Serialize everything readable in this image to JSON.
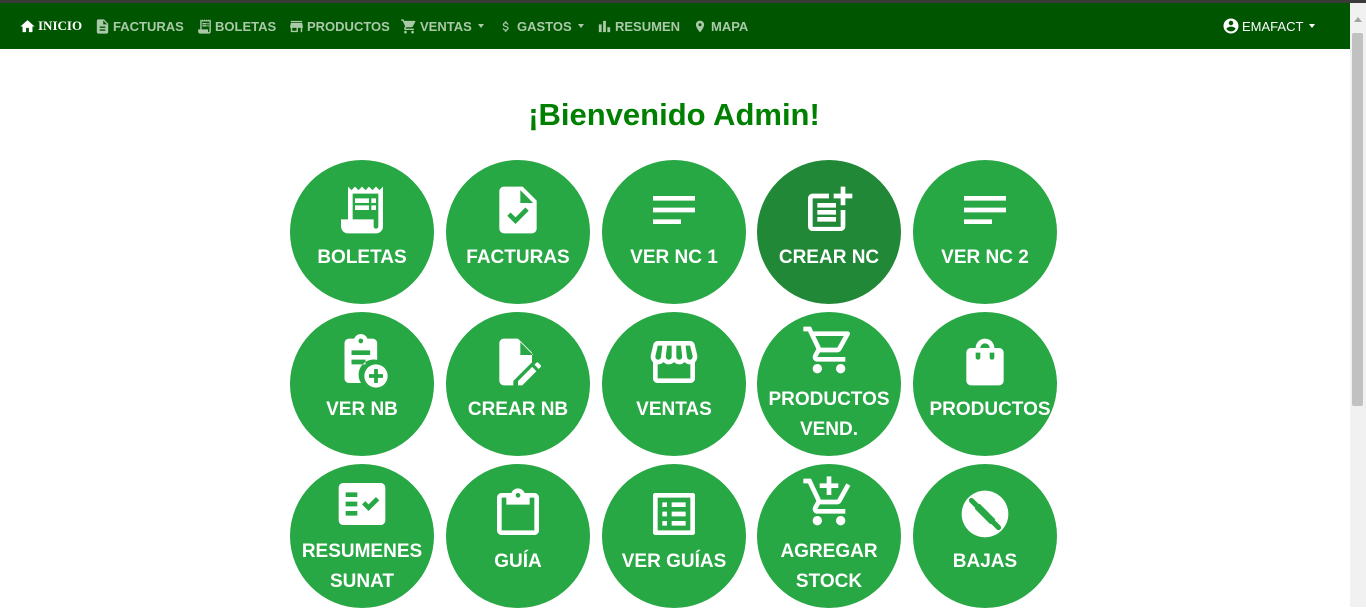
{
  "navbar": {
    "items": [
      {
        "label": "INICIO",
        "icon": "home-icon"
      },
      {
        "label": "FACTURAS",
        "icon": "document-icon"
      },
      {
        "label": "BOLETAS",
        "icon": "receipt-icon"
      },
      {
        "label": "PRODUCTOS",
        "icon": "store-icon"
      },
      {
        "label": "VENTAS",
        "icon": "cart-icon"
      },
      {
        "label": "GASTOS",
        "icon": "dollar-icon"
      },
      {
        "label": "RESUMEN",
        "icon": "bar-chart-icon"
      },
      {
        "label": "MAPA",
        "icon": "map-pin-icon"
      }
    ],
    "user": {
      "label": "EMAFACT",
      "icon": "account-circle-icon"
    }
  },
  "main": {
    "welcome": "¡Bienvenido Admin!",
    "tiles": [
      {
        "label": "BOLETAS",
        "icon": "receipt-icon"
      },
      {
        "label": "FACTURAS",
        "icon": "file-check-icon"
      },
      {
        "label": "VER NC 1",
        "icon": "notes-icon"
      },
      {
        "label": "CREAR NC",
        "icon": "post-add-icon"
      },
      {
        "label": "VER NC 2",
        "icon": "notes-icon"
      },
      {
        "label": "VER NB",
        "icon": "clipboard-add-icon"
      },
      {
        "label": "CREAR NB",
        "icon": "file-edit-icon"
      },
      {
        "label": "VENTAS",
        "icon": "storefront-icon"
      },
      {
        "label": "PRODUCTOS",
        "label2": "VEND.",
        "icon": "shopping-cart-icon"
      },
      {
        "label": "PRODUCTOS",
        "icon": "shopping-bag-icon"
      },
      {
        "label": "RESUMENES",
        "label2": "SUNAT",
        "icon": "fact-check-icon"
      },
      {
        "label": "GUÍA",
        "icon": "clipboard-icon"
      },
      {
        "label": "VER GUÍAS",
        "icon": "list-alt-icon"
      },
      {
        "label": "AGREGAR",
        "label2": "STOCK",
        "icon": "add-cart-icon"
      },
      {
        "label": "BAJAS",
        "icon": "block-icon"
      }
    ]
  },
  "colors": {
    "navbar_bg": "#005500",
    "nav_text": "#a9c9a9",
    "tile_green": "#28a745",
    "tile_active": "#218838",
    "welcome_green": "#008000"
  }
}
